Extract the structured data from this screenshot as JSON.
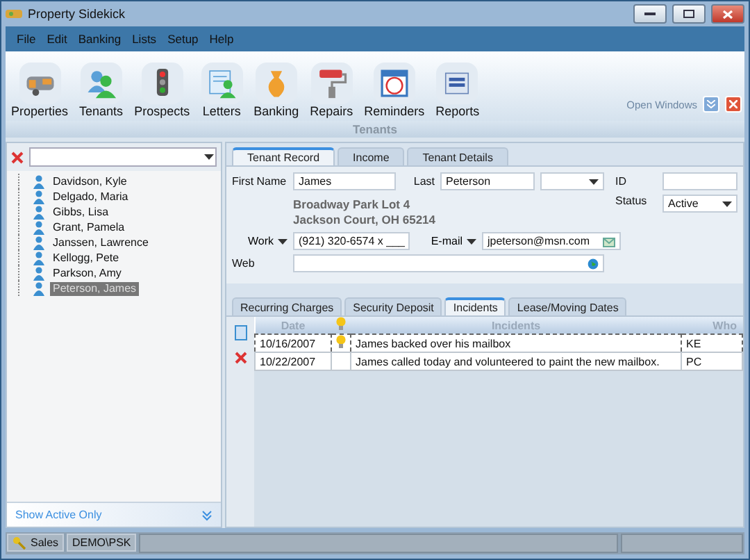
{
  "window": {
    "title": "Property Sidekick"
  },
  "menu": [
    "File",
    "Edit",
    "Banking",
    "Lists",
    "Setup",
    "Help"
  ],
  "toolbar": [
    {
      "label": "Properties"
    },
    {
      "label": "Tenants"
    },
    {
      "label": "Prospects"
    },
    {
      "label": "Letters"
    },
    {
      "label": "Banking"
    },
    {
      "label": "Repairs"
    },
    {
      "label": "Reminders"
    },
    {
      "label": "Reports"
    }
  ],
  "open_windows": "Open Windows",
  "section_title": "Tenants",
  "tenants": [
    {
      "name": "Davidson, Kyle",
      "selected": false
    },
    {
      "name": "Delgado, Maria",
      "selected": false
    },
    {
      "name": "Gibbs, Lisa",
      "selected": false
    },
    {
      "name": "Grant, Pamela",
      "selected": false
    },
    {
      "name": "Janssen, Lawrence",
      "selected": false
    },
    {
      "name": "Kellogg, Pete",
      "selected": false
    },
    {
      "name": "Parkson, Amy",
      "selected": false
    },
    {
      "name": "Peterson, James",
      "selected": true
    }
  ],
  "show_active_only": "Show Active Only",
  "tabs": [
    {
      "label": "Tenant Record",
      "selected": true
    },
    {
      "label": "Income",
      "selected": false
    },
    {
      "label": "Tenant Details",
      "selected": false
    }
  ],
  "form": {
    "first_name_label": "First Name",
    "first_name": "James",
    "last_label": "Last",
    "last_name": "Peterson",
    "id_label": "ID",
    "status_label": "Status",
    "status": "Active",
    "address": [
      "Broadway Park Lot 4",
      "Jackson Court, OH 65214"
    ],
    "phone_type": "Work",
    "phone": "(921) 320-6574 x ___",
    "email_label": "E-mail",
    "email": "jpeterson@msn.com",
    "web_label": "Web"
  },
  "subtabs": [
    {
      "label": "Recurring Charges",
      "selected": false
    },
    {
      "label": "Security Deposit",
      "selected": false
    },
    {
      "label": "Incidents",
      "selected": true
    },
    {
      "label": "Lease/Moving Dates",
      "selected": false
    }
  ],
  "incidents": {
    "columns": [
      "Date",
      "Incidents",
      "Who"
    ],
    "rows": [
      {
        "date": "10/16/2007",
        "flagged": true,
        "text": "James backed over his mailbox",
        "who": "KE"
      },
      {
        "date": "10/22/2007",
        "flagged": false,
        "text": "James called today and volunteered to paint the new mailbox.",
        "who": "PC"
      }
    ]
  },
  "status_bar": {
    "user": "Sales",
    "database": "DEMO\\PSK"
  }
}
